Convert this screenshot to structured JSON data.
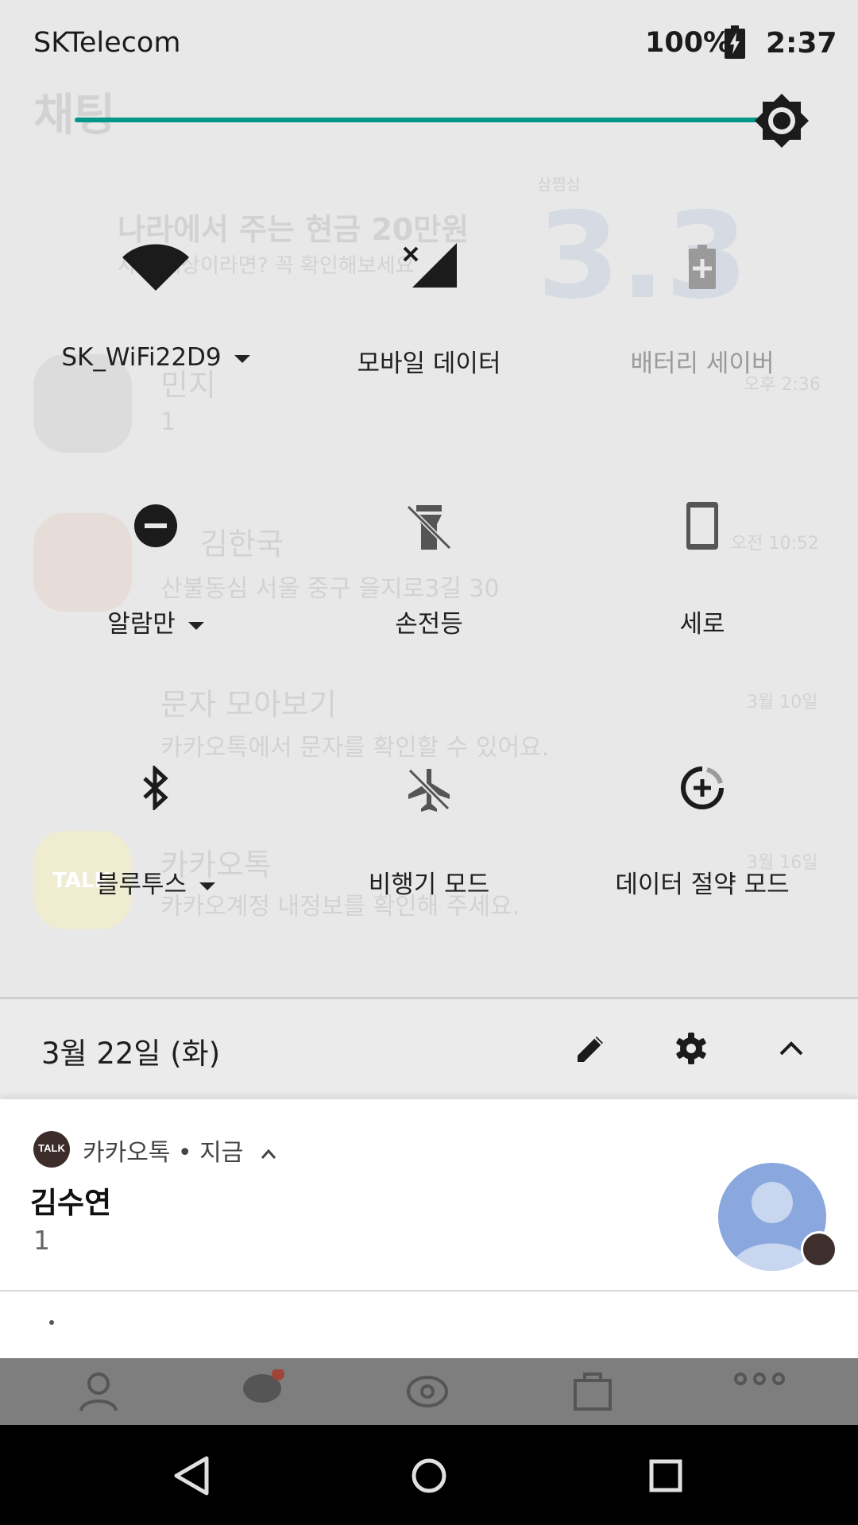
{
  "status_bar": {
    "carrier": "SKTelecom",
    "battery": "100%",
    "time": "2:37"
  },
  "brightness": {
    "level": 0.95
  },
  "background_app": {
    "title": "채팅",
    "banner_title": "나라에서 주는 현금 20만원",
    "banner_subtitle": "사업 대상이라면? 꼭 확인해보세요",
    "banner_brand": "삼쩜삼",
    "banner_number": "3.3",
    "chats": [
      {
        "name": "민지",
        "preview": "1",
        "time": "오후 2:36"
      },
      {
        "name": "김한국",
        "preview": "산불동심 서울 중구 을지로3길 30",
        "time": "오전 10:52"
      },
      {
        "name": "문자 모아보기",
        "preview": "카카오톡에서 문자를 확인할 수 있어요.",
        "time": "3월 10일"
      },
      {
        "name": "카카오톡",
        "preview": "카카오계정 내정보를 확인해 주세요.",
        "time": "3월 16일"
      }
    ],
    "avatar_talk_label": "TALK"
  },
  "tiles": [
    {
      "label": "SK_WiFi22D9",
      "icon": "wifi-icon",
      "caret": true,
      "dim": false
    },
    {
      "label": "모바일 데이터",
      "icon": "mobile-data-off-icon",
      "caret": false,
      "dim": false
    },
    {
      "label": "배터리 세이버",
      "icon": "battery-saver-icon",
      "caret": false,
      "dim": true
    },
    {
      "label": "알람만",
      "icon": "do-not-disturb-icon",
      "caret": true,
      "dim": false
    },
    {
      "label": "손전등",
      "icon": "flashlight-off-icon",
      "caret": false,
      "dim": false
    },
    {
      "label": "세로",
      "icon": "portrait-icon",
      "caret": false,
      "dim": false
    },
    {
      "label": "블루투스",
      "icon": "bluetooth-icon",
      "caret": true,
      "dim": false
    },
    {
      "label": "비행기 모드",
      "icon": "airplane-off-icon",
      "caret": false,
      "dim": false
    },
    {
      "label": "데이터 절약 모드",
      "icon": "data-saver-icon",
      "caret": false,
      "dim": false
    }
  ],
  "date_row": {
    "date": "3월 22일 (화)"
  },
  "notification": {
    "app_icon_label": "TALK",
    "header": "카카오톡 • 지금",
    "title": "김수연",
    "body": "1"
  },
  "colors": {
    "accent": "#009688",
    "shade_bg": "#e8e8e8",
    "kakao_brown": "#3c2d2b"
  }
}
